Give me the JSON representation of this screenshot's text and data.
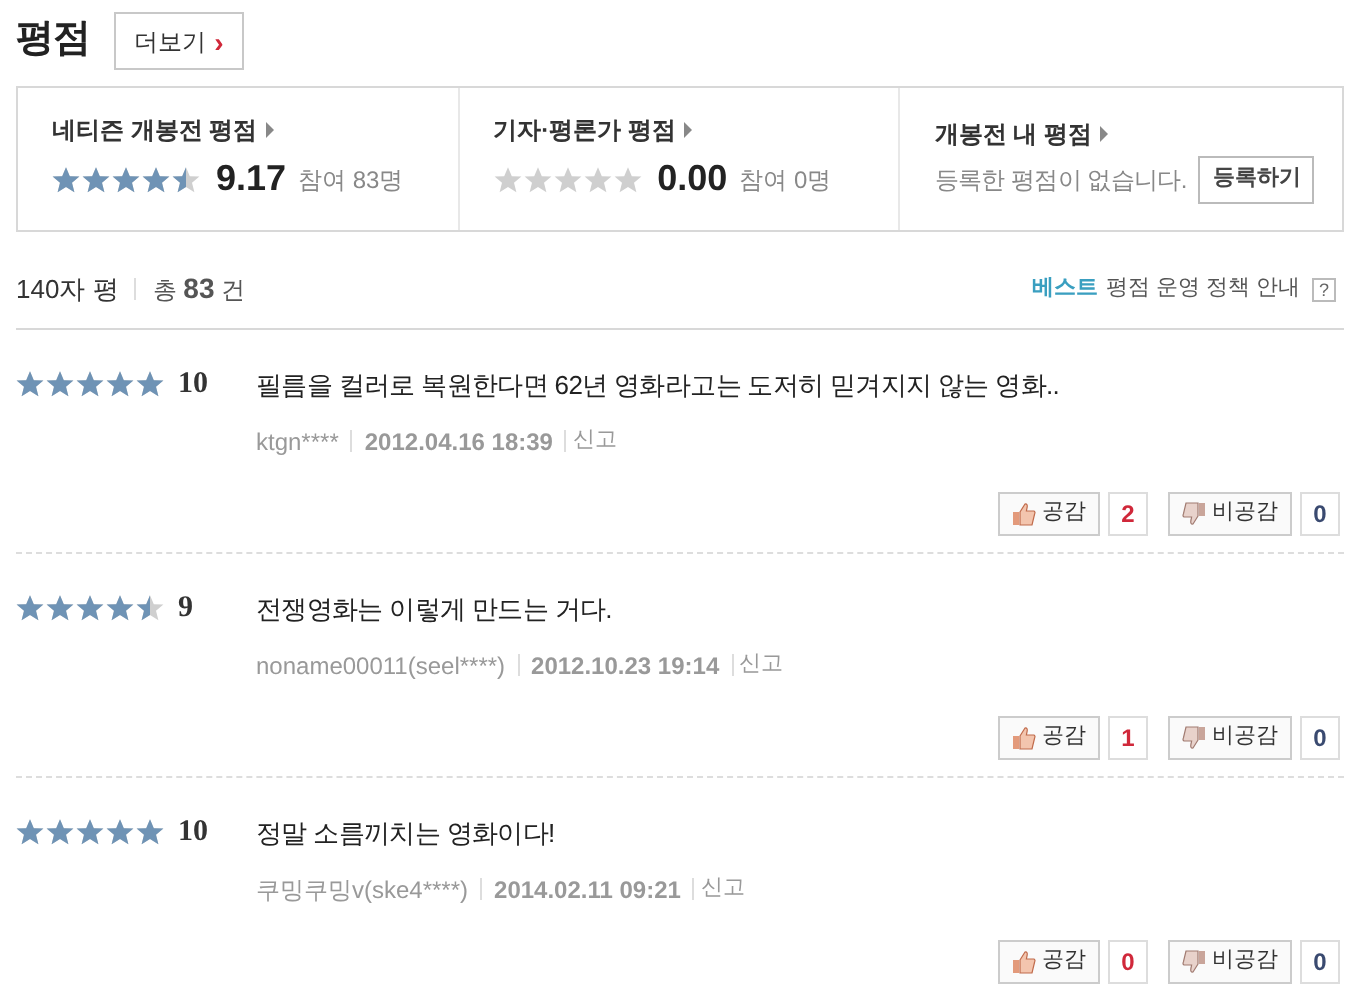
{
  "header": {
    "title": "평점",
    "more_button": "더보기",
    "more_arrow": "›"
  },
  "summary": [
    {
      "label": "네티즌 개봉전 평점",
      "stars": 4.5,
      "score": "9.17",
      "participants": "참여 83명"
    },
    {
      "label": "기자·평론가 평점",
      "stars": 0,
      "score": "0.00",
      "participants": "참여 0명"
    },
    {
      "label": "개봉전 내 평점",
      "message": "등록한 평점이 없습니다.",
      "register_button": "등록하기"
    }
  ],
  "list_header": {
    "tab": "140자 평",
    "total_prefix": "총",
    "total_count": "83",
    "total_suffix": "건",
    "best": "베스트",
    "policy": "평점 운영 정책 안내",
    "help": "?"
  },
  "reviews": [
    {
      "stars": 5,
      "score": "10",
      "text": "필름을 컬러로 복원한다면 62년 영화라고는 도저히 믿겨지지 않는 영화..",
      "author": "ktgn****",
      "date": "2012.04.16 18:39",
      "report": "신고",
      "like_label": "공감",
      "likes": "2",
      "dislike_label": "비공감",
      "dislikes": "0"
    },
    {
      "stars": 4.5,
      "score": "9",
      "text": "전쟁영화는 이렇게 만드는 거다.",
      "author": "noname00011(seel****)",
      "date": "2012.10.23 19:14",
      "report": "신고",
      "like_label": "공감",
      "likes": "1",
      "dislike_label": "비공감",
      "dislikes": "0"
    },
    {
      "stars": 5,
      "score": "10",
      "text": "정말 소름끼치는 영화이다!",
      "author": "쿠밍쿠밍v(ske4****)",
      "date": "2014.02.11 09:21",
      "report": "신고",
      "like_label": "공감",
      "likes": "0",
      "dislike_label": "비공감",
      "dislikes": "0"
    }
  ]
}
